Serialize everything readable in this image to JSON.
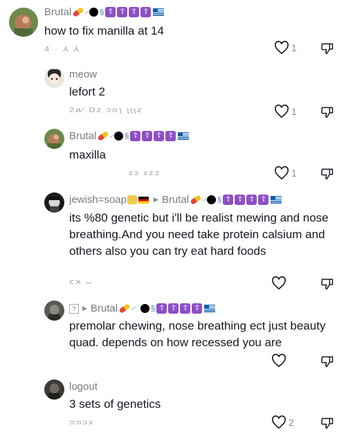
{
  "comments": [
    {
      "username": "Brutal",
      "text": "how to fix manilla at 14",
      "meta": "4 ·  ⅄  ⅄",
      "likes": "1"
    },
    {
      "username": "meow",
      "text": "lefort 2",
      "meta": "2ᴎ∕.Dᴢ   ɔoɿ ʅʅʅz",
      "likes": "1"
    },
    {
      "username": "Brutal",
      "text": "maxilla",
      "meta": "ᴤɔ ᴤᴢᴢ",
      "likes": "1"
    },
    {
      "username": "jewish=soap",
      "reply_to": "Brutal",
      "text": "its %80 genetic but i'll be realist mewing and nose breathing.And you need take protein calsium and others also you can try eat hard foods",
      "meta": "ⅽⅹ  ᴗ",
      "likes": ""
    },
    {
      "username": "?",
      "reply_to": "Brutal",
      "text": "premolar chewing, nose breathing ect just beauty quad. depends on how recessed you are",
      "meta": "",
      "likes": ""
    },
    {
      "username": "logout",
      "text": "3 sets of genetics",
      "meta": "ᴝᴝɔx",
      "likes": "2"
    }
  ],
  "icons": {
    "like": "heart-outline-icon",
    "dislike": "thumbs-down-outline-icon"
  },
  "colors": {
    "text": "#161823",
    "muted": "#8a8b91",
    "cross_badge": "#8e4fc6"
  }
}
